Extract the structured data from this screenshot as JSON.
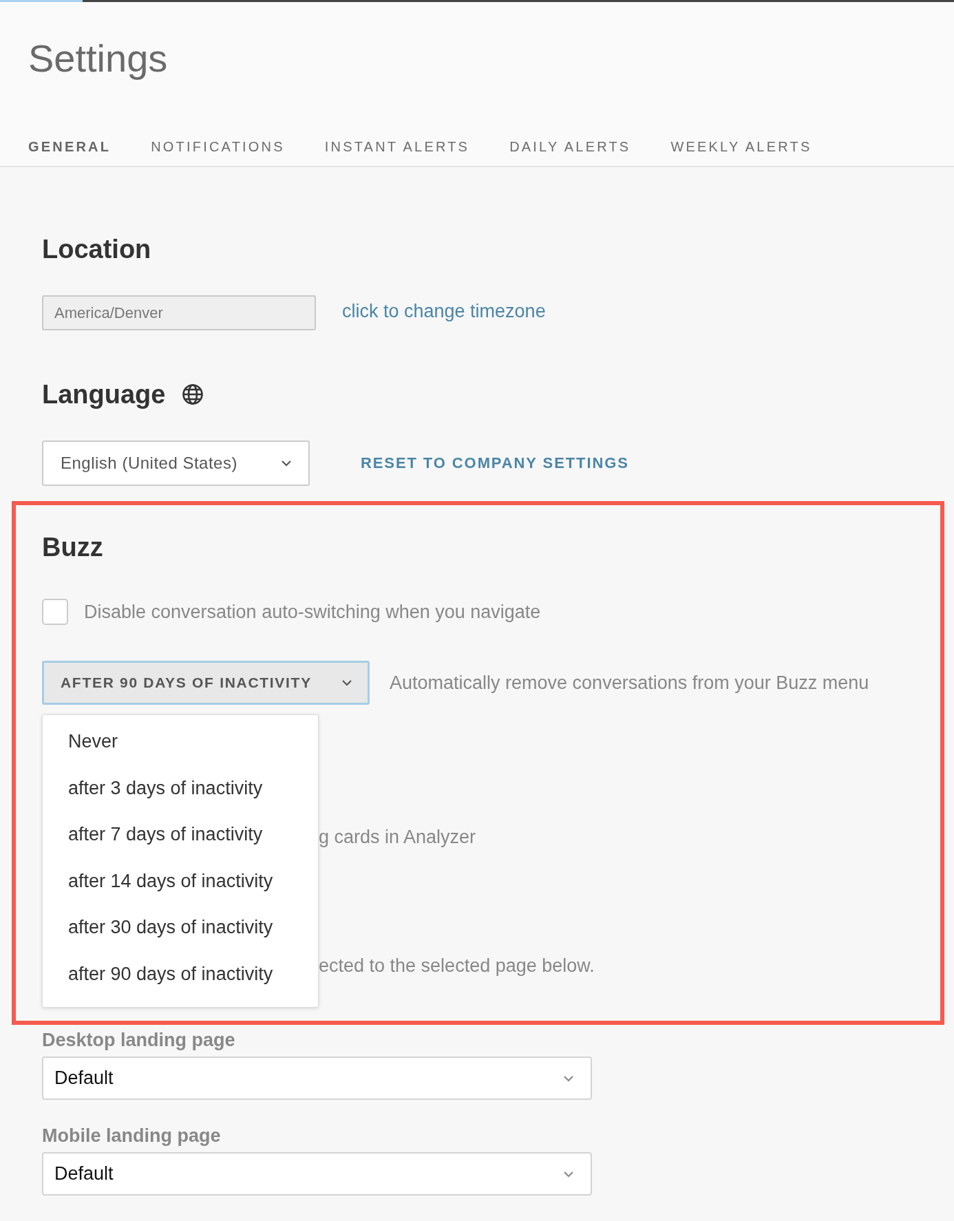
{
  "page": {
    "title": "Settings"
  },
  "tabs": [
    {
      "label": "GENERAL",
      "selected": true
    },
    {
      "label": "NOTIFICATIONS",
      "selected": false
    },
    {
      "label": "INSTANT ALERTS",
      "selected": false
    },
    {
      "label": "DAILY ALERTS",
      "selected": false
    },
    {
      "label": "WEEKLY ALERTS",
      "selected": false
    }
  ],
  "location": {
    "heading": "Location",
    "timezone_field": {
      "value": "America/Denver",
      "disabled": true
    },
    "change_link": "click to change timezone"
  },
  "language": {
    "heading": "Language",
    "select": {
      "value": "English (United States)"
    },
    "reset_link": "RESET TO COMPANY SETTINGS"
  },
  "buzz": {
    "highlighted": true,
    "heading": "Buzz",
    "auto_switch": {
      "label": "Disable conversation auto-switching when you navigate",
      "checked": false
    },
    "auto_remove": {
      "value": "AFTER 90 DAYS OF INACTIVITY",
      "expanded": true,
      "focused": true,
      "description": "Automatically remove conversations from your Buzz menu",
      "options": [
        {
          "label": "Never"
        },
        {
          "label": "after 3 days of inactivity"
        },
        {
          "label": "after 7 days of inactivity"
        },
        {
          "label": "after 14 days of inactivity"
        },
        {
          "label": "after 30 days of inactivity"
        },
        {
          "label": "after 90 days of inactivity"
        }
      ]
    },
    "partial_texts": [
      "g cards in Analyzer",
      "ected to the selected page below."
    ]
  },
  "landing": [
    {
      "label": "Desktop landing page",
      "value": "Default"
    },
    {
      "label": "Mobile landing page",
      "value": "Default"
    }
  ]
}
